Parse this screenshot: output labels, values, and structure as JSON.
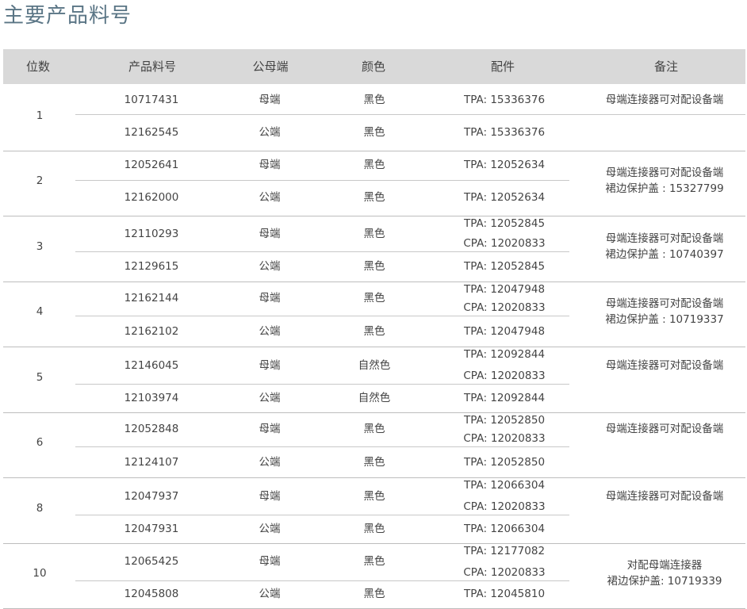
{
  "title": "主要产品料号",
  "headers": {
    "positions": "位数",
    "part_number": "产品料号",
    "gender": "公母端",
    "color": "颜色",
    "accessories": "配件",
    "notes": "备注"
  },
  "groups": [
    {
      "positions": "1",
      "rows": [
        {
          "part": "10717431",
          "gender": "母端",
          "color": "黑色",
          "acc": [
            "TPA: 15336376"
          ]
        },
        {
          "part": "12162545",
          "gender": "公端",
          "color": "黑色",
          "acc": [
            "TPA: 15336376"
          ]
        }
      ],
      "notes": [
        "母端连接器可对配设备端"
      ],
      "notes_mode": "first"
    },
    {
      "positions": "2",
      "rows": [
        {
          "part": "12052641",
          "gender": "母端",
          "color": "黑色",
          "acc": [
            "TPA: 12052634"
          ]
        },
        {
          "part": "12162000",
          "gender": "公端",
          "color": "黑色",
          "acc": [
            "TPA: 12052634"
          ]
        }
      ],
      "notes": [
        "母端连接器可对配设备端",
        "裙边保护盖 : 15327799"
      ],
      "notes_mode": "center"
    },
    {
      "positions": "3",
      "rows": [
        {
          "part": "12110293",
          "gender": "母端",
          "color": "黑色",
          "acc": [
            "TPA: 12052845",
            "CPA: 12020833"
          ]
        },
        {
          "part": "12129615",
          "gender": "公端",
          "color": "黑色",
          "acc": [
            "TPA: 12052845"
          ]
        }
      ],
      "notes": [
        "母端连接器可对配设备端",
        "裙边保护盖 : 10740397"
      ],
      "notes_mode": "center"
    },
    {
      "positions": "4",
      "rows": [
        {
          "part": "12162144",
          "gender": "母端",
          "color": "黑色",
          "acc": [
            "TPA: 12047948",
            "CPA: 12020833"
          ]
        },
        {
          "part": "12162102",
          "gender": "公端",
          "color": "黑色",
          "acc": [
            "TPA: 12047948"
          ]
        }
      ],
      "notes": [
        "母端连接器可对配设备端",
        "裙边保护盖 : 10719337"
      ],
      "notes_mode": "center"
    },
    {
      "positions": "5",
      "rows": [
        {
          "part": "12146045",
          "gender": "母端",
          "color": "自然色",
          "acc": [
            "TPA: 12092844",
            "CPA: 12020833"
          ]
        },
        {
          "part": "12103974",
          "gender": "公端",
          "color": "自然色",
          "acc": [
            "TPA: 12092844"
          ]
        }
      ],
      "notes": [
        "母端连接器可对配设备端"
      ],
      "notes_mode": "first"
    },
    {
      "positions": "6",
      "rows": [
        {
          "part": "12052848",
          "gender": "母端",
          "color": "黑色",
          "acc": [
            "TPA: 12052850",
            "CPA: 12020833"
          ]
        },
        {
          "part": "12124107",
          "gender": "公端",
          "color": "黑色",
          "acc": [
            "TPA: 12052850"
          ]
        }
      ],
      "notes": [
        "母端连接器可对配设备端"
      ],
      "notes_mode": "first"
    },
    {
      "positions": "8",
      "rows": [
        {
          "part": "12047937",
          "gender": "母端",
          "color": "黑色",
          "acc": [
            "TPA: 12066304",
            "CPA: 12020833"
          ]
        },
        {
          "part": "12047931",
          "gender": "公端",
          "color": "黑色",
          "acc": [
            "TPA: 12066304"
          ]
        }
      ],
      "notes": [
        "母端连接器可对配设备端"
      ],
      "notes_mode": "first"
    },
    {
      "positions": "10",
      "rows": [
        {
          "part": "12065425",
          "gender": "母端",
          "color": "黑色",
          "acc": [
            "TPA: 12177082",
            "CPA: 12020833"
          ]
        },
        {
          "part": "12045808",
          "gender": "公端",
          "color": "黑色",
          "acc": [
            "TPA: 12045810"
          ]
        }
      ],
      "notes": [
        "对配母端连接器",
        "裙边保护盖: 10719339"
      ],
      "notes_mode": "center"
    }
  ]
}
